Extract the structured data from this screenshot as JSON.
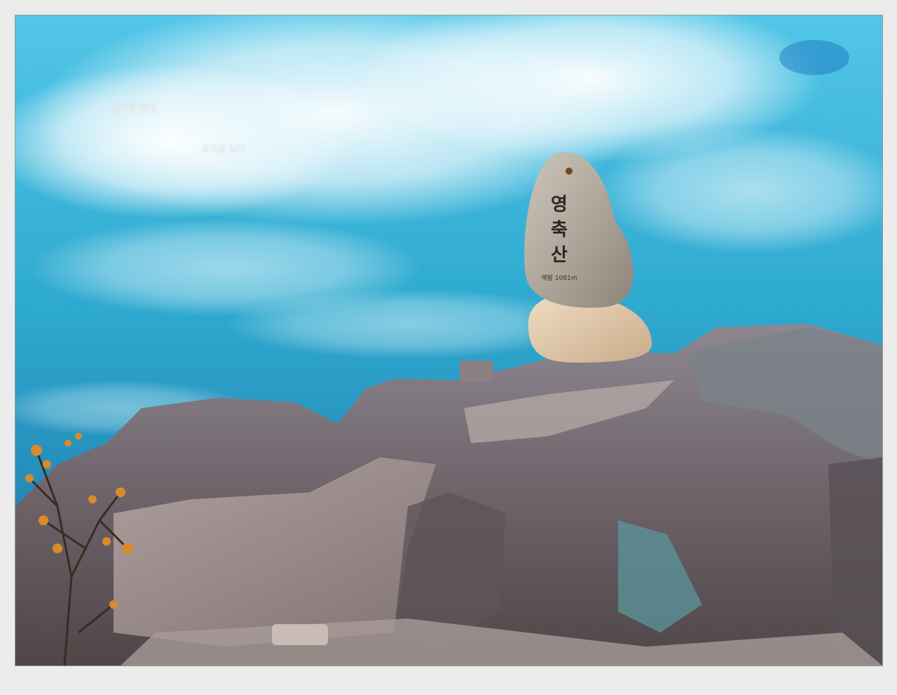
{
  "watermarks": [
    "생각을 담다",
    "생각을 담다"
  ],
  "stone": {
    "name_chars": [
      "영",
      "축",
      "산"
    ],
    "elevation": "해발 1081m"
  },
  "colors": {
    "sky": "#2ea9cf",
    "cloud": "#ffffff",
    "rock": "#6f6568",
    "stone": "#bdb4a8",
    "base_stone": "#dcc4a6",
    "leaves": "#d98a2a",
    "frame_bg": "#ececec"
  }
}
